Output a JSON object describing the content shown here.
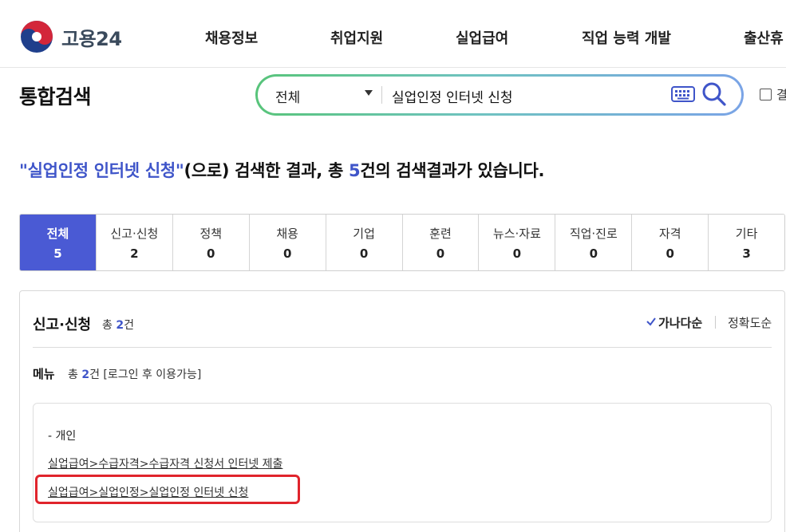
{
  "header": {
    "logo_text": "고용24",
    "nav": [
      "채용정보",
      "취업지원",
      "실업급여",
      "직업 능력 개발",
      "출산휴"
    ]
  },
  "search": {
    "page_title": "통합검색",
    "scope": "전체",
    "query": "실업인정 인터넷 신청",
    "checkbox_label": "결"
  },
  "result": {
    "quote_open": "\"",
    "keyword": "실업인정 인터넷 신청",
    "quote_close": "\"",
    "mid_text": "(으로) 검색한 결과, 총 ",
    "count": "5",
    "end_text": "건의 검색결과가 있습니다."
  },
  "tabs": [
    {
      "label": "전체",
      "count": "5",
      "active": true
    },
    {
      "label": "신고·신청",
      "count": "2"
    },
    {
      "label": "정책",
      "count": "0"
    },
    {
      "label": "채용",
      "count": "0"
    },
    {
      "label": "기업",
      "count": "0"
    },
    {
      "label": "훈련",
      "count": "0"
    },
    {
      "label": "뉴스·자료",
      "count": "0"
    },
    {
      "label": "직업·진로",
      "count": "0"
    },
    {
      "label": "자격",
      "count": "0"
    },
    {
      "label": "기타",
      "count": "3"
    }
  ],
  "section": {
    "title": "신고·신청",
    "total_prefix": "총 ",
    "total_count": "2",
    "total_suffix": "건",
    "sort_a": "가나다순",
    "sort_b": "정확도순",
    "menu_title": "메뉴",
    "menu_prefix": "총 ",
    "menu_count": "2",
    "menu_suffix": "건 [로그인 후 이용가능]",
    "group": "- 개인",
    "links": [
      "실업급여>수급자격>수급자격 신청서 인터넷 제출",
      "실업급여>실업인정>실업인정 인터넷 신청"
    ]
  },
  "colors": {
    "accent": "#4a5ad4",
    "highlight_box": "#e0242c"
  }
}
